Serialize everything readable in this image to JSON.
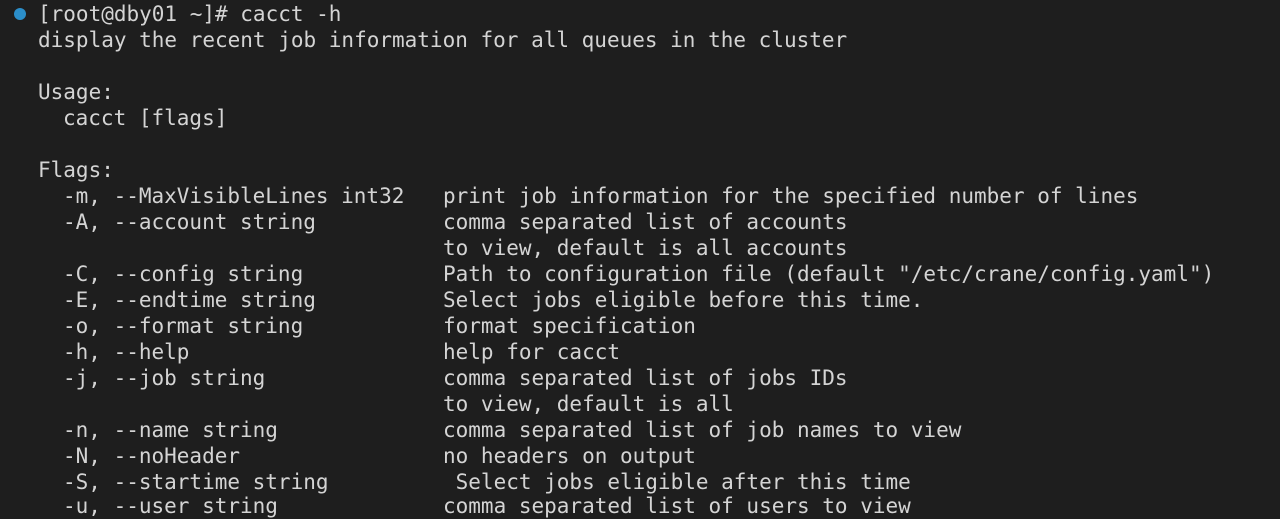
{
  "colors": {
    "background": "#1e1e1e",
    "foreground": "#d4d4d4",
    "prompt_dot": "#2b8ec9"
  },
  "prompt": {
    "dot_icon": "circle-dot-icon",
    "command": "[root@dby01 ~]# cacct -h"
  },
  "description": "display the recent job information for all queues in the cluster",
  "usage": {
    "heading": "Usage:",
    "syntax": "cacct [flags]"
  },
  "flags": {
    "heading": "Flags:",
    "rows": [
      {
        "flag": "-m, --MaxVisibleLines int32",
        "desc": "print job information for the specified number of lines"
      },
      {
        "flag": "-A, --account string",
        "desc": "comma separated list of accounts"
      },
      {
        "flag": "",
        "desc": "to view, default is all accounts"
      },
      {
        "flag": "-C, --config string",
        "desc": "Path to configuration file (default \"/etc/crane/config.yaml\")"
      },
      {
        "flag": "-E, --endtime string",
        "desc": "Select jobs eligible before this time."
      },
      {
        "flag": "-o, --format string",
        "desc": "format specification"
      },
      {
        "flag": "-h, --help",
        "desc": "help for cacct"
      },
      {
        "flag": "-j, --job string",
        "desc": "comma separated list of jobs IDs"
      },
      {
        "flag": "",
        "desc": "to view, default is all"
      },
      {
        "flag": "-n, --name string",
        "desc": "comma separated list of job names to view"
      },
      {
        "flag": "-N, --noHeader",
        "desc": "no headers on output"
      },
      {
        "flag": "-S, --startime string",
        "desc": " Select jobs eligible after this time"
      },
      {
        "flag": "-u, --user string",
        "desc": "comma separated list of users to view"
      }
    ]
  }
}
